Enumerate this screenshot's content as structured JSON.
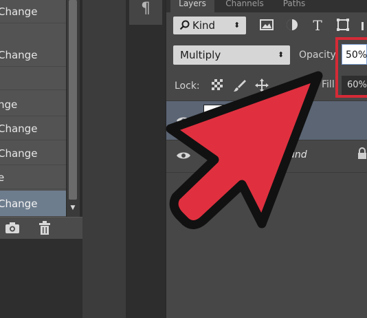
{
  "history": {
    "items": [
      {
        "label": "Change",
        "selected": false
      },
      {
        "label": "Change",
        "selected": false
      },
      {
        "label": "",
        "selected": false
      },
      {
        "label": "nge",
        "selected": false
      },
      {
        "label": "Change",
        "selected": false
      },
      {
        "label": "Change",
        "selected": false
      },
      {
        "label": "e",
        "selected": false
      },
      {
        "label": "Change",
        "selected": true
      }
    ],
    "icons": {
      "snapshot": "camera-icon",
      "delete": "trash-icon",
      "scroll_down": "triangle-down-icon"
    }
  },
  "paragraph_icon": "¶",
  "layers_panel": {
    "tabs": [
      {
        "label": "Layers",
        "active": true
      },
      {
        "label": "Channels",
        "active": false
      },
      {
        "label": "Paths",
        "active": false
      }
    ],
    "filter": {
      "kind_label": "Kind",
      "icons": [
        "image-filter-icon",
        "adjustment-filter-icon",
        "type-filter-icon",
        "shape-filter-icon",
        "smart-object-filter-icon"
      ]
    },
    "blend_mode": "Multiply",
    "opacity_label": "Opacity",
    "opacity_value": "50%",
    "lock_label": "Lock:",
    "fill_label": "Fill",
    "fill_value": "60%",
    "layers": [
      {
        "name": "",
        "selected": true
      },
      {
        "name": "und",
        "selected": false,
        "locked": true
      }
    ]
  },
  "annotation": {
    "color": "#e0303f",
    "outline": "#111111"
  }
}
